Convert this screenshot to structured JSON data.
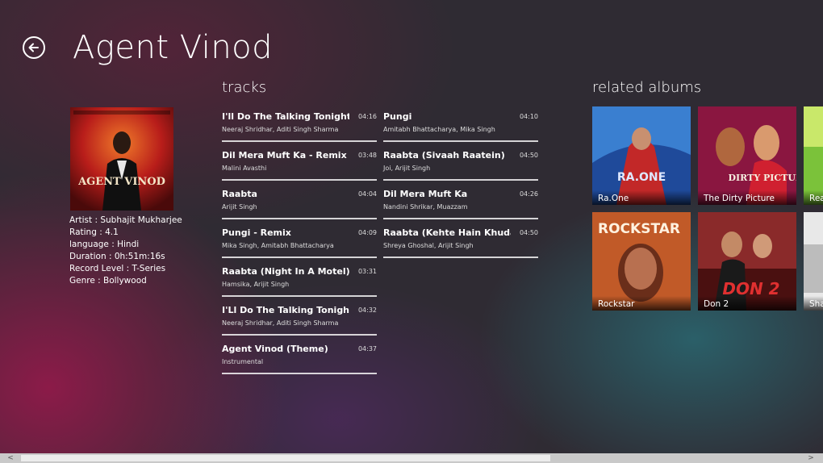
{
  "header": {
    "title": "Agent Vinod"
  },
  "album": {
    "cover_text": "AGENT VINOD",
    "info": [
      "Artist : Subhajit Mukharjee",
      "Rating : 4.1",
      "language : Hindi",
      "Duration : 0h:51m:16s",
      "Record Level : T-Series",
      "Genre : Bollywood"
    ]
  },
  "tracks": {
    "heading": "tracks",
    "col1": [
      {
        "title": "I'll Do The Talking Tonight",
        "artist": "Neeraj Shridhar, Aditi Singh Sharma",
        "duration": "04:16"
      },
      {
        "title": "Dil Mera Muft Ka - Remix",
        "artist": "Malini Avasthi",
        "duration": "03:48"
      },
      {
        "title": "Raabta",
        "artist": "Arijit Singh",
        "duration": "04:04"
      },
      {
        "title": "Pungi - Remix",
        "artist": "Mika Singh, Amitabh Bhattacharya",
        "duration": "04:09"
      },
      {
        "title": "Raabta (Night In A Motel)",
        "artist": "Hamsika, Arijit Singh",
        "duration": "03:31"
      },
      {
        "title": "I'Ll Do The Talking Tonight -...",
        "artist": "Neeraj Shridhar, Aditi Singh Sharma",
        "duration": "04:32"
      },
      {
        "title": "Agent Vinod (Theme)",
        "artist": "Instrumental",
        "duration": "04:37"
      }
    ],
    "col2": [
      {
        "title": "Pungi",
        "artist": "Amitabh Bhattacharya, Mika Singh",
        "duration": "04:10"
      },
      {
        "title": "Raabta (Sivaah Raatein)",
        "artist": "Joi, Arijit Singh",
        "duration": "04:50"
      },
      {
        "title": "Dil Mera Muft Ka",
        "artist": "Nandini Shrikar, Muazzam",
        "duration": "04:26"
      },
      {
        "title": "Raabta (Kehte Hain Khuda Ne)",
        "artist": "Shreya Ghoshal, Arijit Singh",
        "duration": "04:50"
      }
    ]
  },
  "related": {
    "heading": "related albums",
    "albums": [
      {
        "label": "Ra.One",
        "art": "RA.ONE"
      },
      {
        "label": "The Dirty Picture",
        "art": "DIRTY PICTURE"
      },
      {
        "label": "Rea"
      },
      {
        "label": "Rockstar",
        "art": "ROCKSTAR"
      },
      {
        "label": "Don 2",
        "art": "DON 2"
      },
      {
        "label": "Sha"
      }
    ]
  },
  "scrollbar": {
    "left_arrow": "<",
    "right_arrow": ">"
  },
  "colors": {
    "accent_bg": "#2f2b33",
    "track_rule": "#ffffff"
  }
}
